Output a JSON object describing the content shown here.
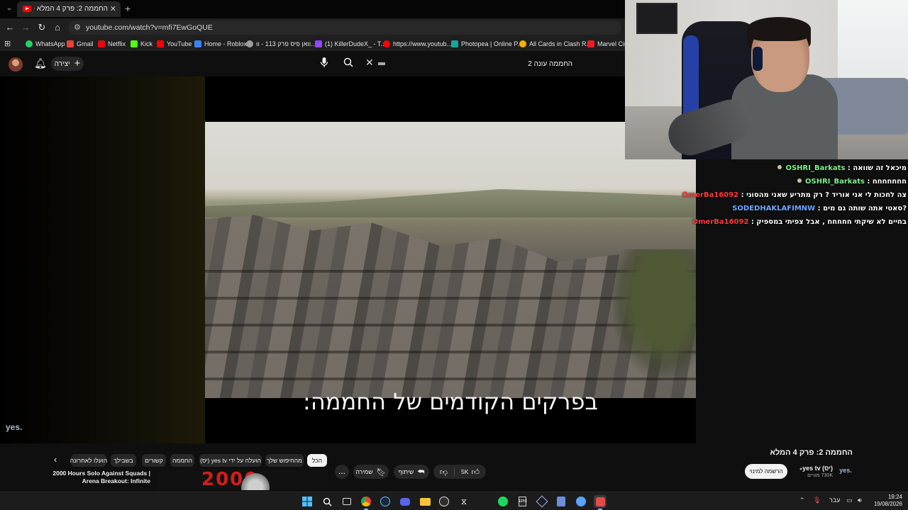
{
  "browser": {
    "tab_title": "החממה 2: פרק 4 המלא - YouTube",
    "url": "youtube.com/watch?v=mfi7EwGoQUE",
    "bookmarks": [
      {
        "label": "WhatsApp",
        "icon": "whatsapp-icon",
        "color": "#25d366"
      },
      {
        "label": "Gmail",
        "icon": "gmail-icon",
        "color": "#ea4335"
      },
      {
        "label": "Netflix",
        "icon": "netflix-icon",
        "color": "#e50914"
      },
      {
        "label": "Kick",
        "icon": "kick-icon",
        "color": "#53fc18"
      },
      {
        "label": "YouTube",
        "icon": "youtube-icon",
        "color": "#ff0000"
      },
      {
        "label": "Home - Roblox",
        "icon": "roblox-icon",
        "color": "#3b82f6"
      },
      {
        "label": "וואן פיס פרק 113 - וו...",
        "icon": "globe-icon",
        "color": "#9e9e9e"
      },
      {
        "label": "(1) KillerDudeX_ - T...",
        "icon": "twitch-icon",
        "color": "#9146ff"
      },
      {
        "label": "https://www.youtub...",
        "icon": "youtube-icon",
        "color": "#ff0000"
      },
      {
        "label": "Photopea | Online P...",
        "icon": "photopea-icon",
        "color": "#18a497"
      },
      {
        "label": "All Cards in Clash R...",
        "icon": "clash-icon",
        "color": "#f5b301"
      },
      {
        "label": "Marvel Cine",
        "icon": "marvel-icon",
        "color": "#ec1d24"
      }
    ]
  },
  "youtube": {
    "create_label": "יצירה",
    "search_value": "החממה עונה 2"
  },
  "video": {
    "subtitle": "בפרקים הקודמים של החממה:",
    "watermark": "yes."
  },
  "chat": [
    {
      "user": "OSHRI_Barkats",
      "text": "מיכאל זה שוואה",
      "color": "#7cf08a",
      "badge": true
    },
    {
      "user": "OSHRI_Barkats",
      "text": "חחחחחחח",
      "color": "#7cf08a",
      "badge": true
    },
    {
      "user": "OmerBa16092",
      "text": "צה לחכות לי אני אוריד ? רק מתריע שאני מהסוני",
      "color": "#ff3a3a",
      "badge": false
    },
    {
      "user": "SODEDHAKLAFIMNW",
      "text": "סאטי אתה שותה גם מים?",
      "color": "#6ea8ff",
      "badge": false
    },
    {
      "user": "OmerBa16092",
      "text": "בחיים לא שיקתי חחחחח , אבל צפיתי במספיק",
      "color": "#ff3a3a",
      "badge": false
    }
  ],
  "chips": [
    "הכל",
    "מהחיפוש שלך",
    "הועלה על ידי yes tv (יס)",
    "החממה",
    "קשורים",
    "בשבילך",
    "הועלו לאחרונה"
  ],
  "recommendation": {
    "title": "2000 Hours Solo Against Squads | Arena Breakout: Infinite",
    "thumb_text": "2000"
  },
  "actions": {
    "more": "...",
    "save": "שמירה",
    "share": "שיתוף",
    "likes": "5K"
  },
  "watch": {
    "title": "החממה 2: פרק 4 המלא",
    "subscribe_label": "הרשמה למינוי",
    "channel_name": "yes tv (יס)",
    "subscribers": "730K מנויים",
    "channel_logo": "yes."
  },
  "taskbar": {
    "lang": "עבר",
    "time": "19:24",
    "date": "19/08/2026"
  }
}
